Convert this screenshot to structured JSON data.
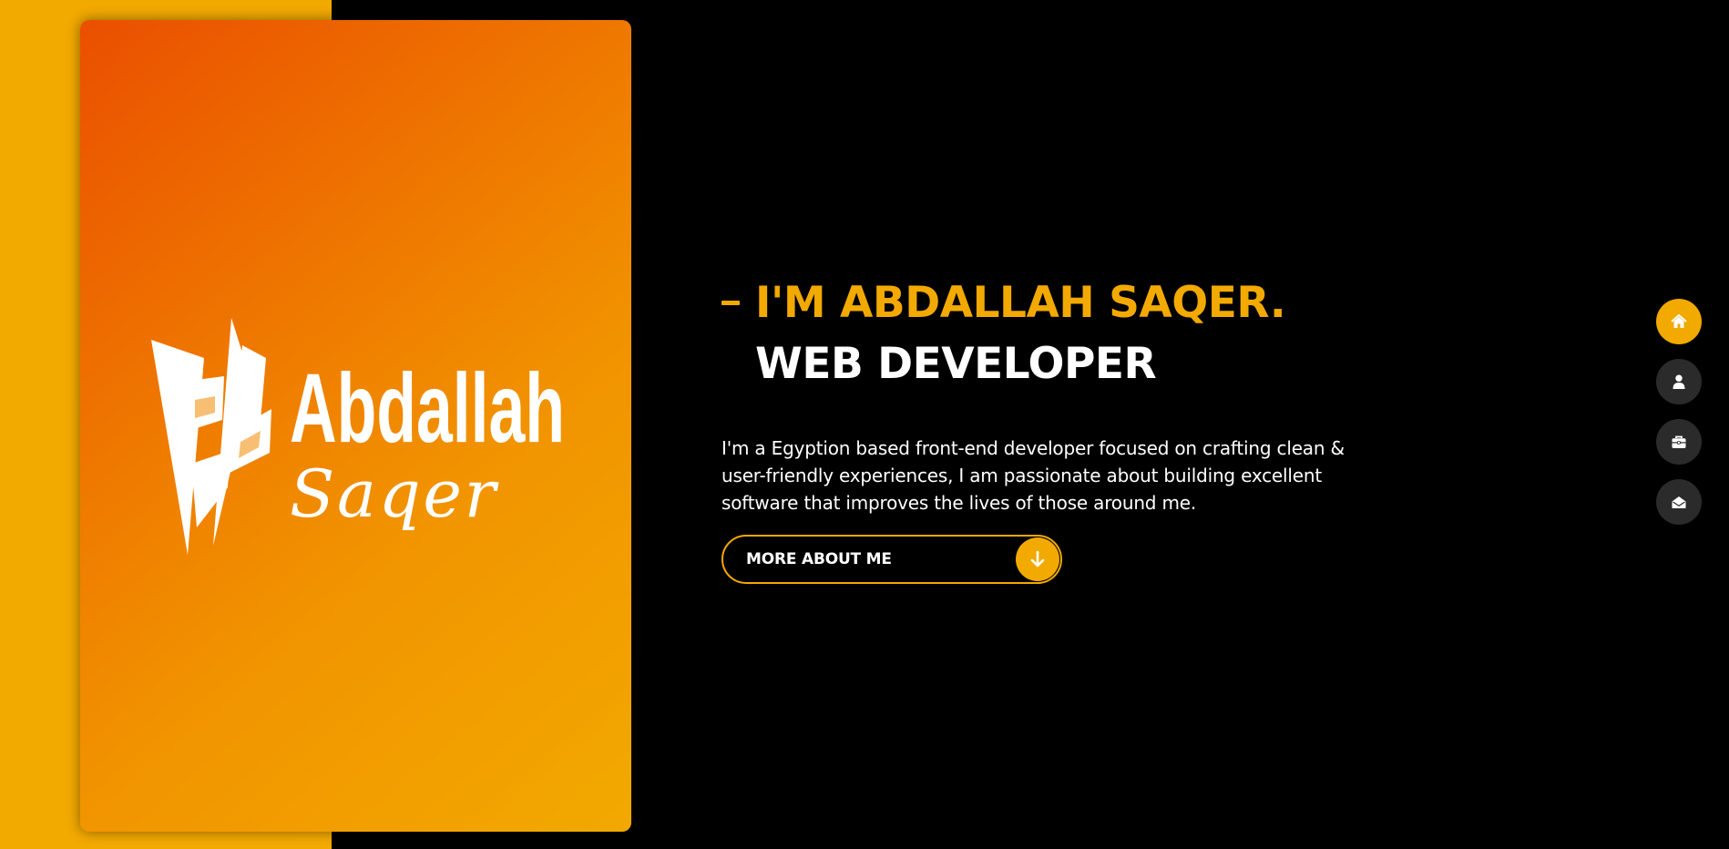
{
  "hero": {
    "logo_name": "Abdallah",
    "logo_script": "Saqer"
  },
  "main": {
    "headline": "I'M ABDALLAH SAQER.",
    "subheadline": "WEB DEVELOPER",
    "bio": "I'm a Egyption based front-end developer focused on crafting clean & user-friendly experiences, I am passionate about building excellent software that improves the lives of those around me.",
    "more_button": {
      "label": "MORE ABOUT ME",
      "icon": "arrow-down-icon"
    }
  },
  "side_nav": {
    "items": [
      {
        "icon": "home-icon",
        "active": true
      },
      {
        "icon": "user-icon",
        "active": false
      },
      {
        "icon": "briefcase-icon",
        "active": false
      },
      {
        "icon": "envelope-open-icon",
        "active": false
      }
    ]
  },
  "colors": {
    "accent": "#f2a900",
    "gradient_start": "#ea4f00",
    "background": "#000000",
    "nav_inactive": "#2b2b2b",
    "text": "#ffffff"
  }
}
